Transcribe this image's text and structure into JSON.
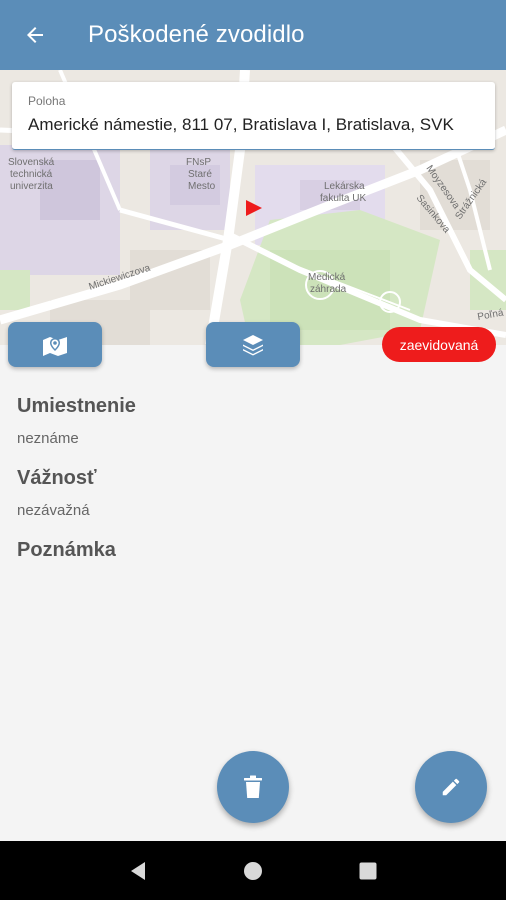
{
  "appbar": {
    "title": "Poškodené zvodidlo",
    "back_icon": "arrow-left-icon"
  },
  "location": {
    "label": "Poloha",
    "value": "Americké námestie, 811 07, Bratislava I, Bratislava, SVK"
  },
  "map": {
    "labels": {
      "stu": [
        "Slovenská",
        "technická",
        "univerzita"
      ],
      "fnp": [
        "FNsP",
        "Staré",
        "Mesto"
      ],
      "lekarska": [
        "Lekárska",
        "fakulta UK"
      ],
      "zahrada": [
        "Medická",
        "záhrada"
      ],
      "street1": "Mickiewiczova",
      "street2": "Moyzesova",
      "street3": "Sasinkova",
      "street4": "Strážnická",
      "street5": "Poľná"
    },
    "marker_color": "#ee1c1c"
  },
  "buttons": {
    "map_icon": "map-marker-icon",
    "layers_icon": "layers-icon"
  },
  "status": {
    "label": "zaevidovaná",
    "color": "#ee1c1c"
  },
  "details": {
    "placement_title": "Umiestnenie",
    "placement_value": "neznáme",
    "severity_title": "Vážnosť",
    "severity_value": "nezávažná",
    "note_title": "Poznámka"
  },
  "actions": {
    "delete_icon": "trash-icon",
    "edit_icon": "pencil-icon"
  },
  "navigation": {
    "back_icon": "nav-back-icon",
    "home_icon": "nav-home-icon",
    "recents_icon": "nav-recents-icon"
  },
  "colors": {
    "primary": "#5b8db8",
    "badge": "#ee1c1c"
  }
}
